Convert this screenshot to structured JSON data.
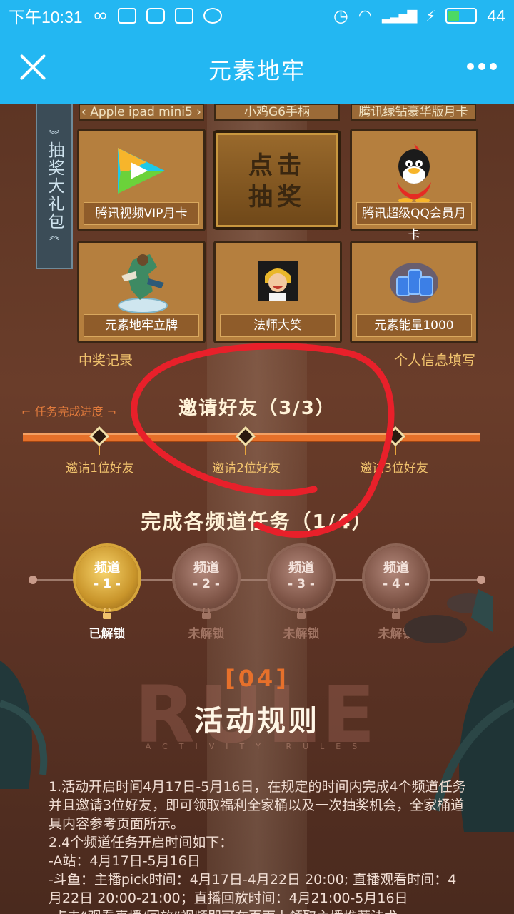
{
  "status_bar": {
    "time": "下午10:31",
    "battery": "44",
    "battery_level": 0.44
  },
  "title_bar": {
    "title": "元素地牢"
  },
  "side_tab": {
    "label": "抽奖大礼包"
  },
  "prizes": {
    "top_row": [
      "‹ Apple ipad mini5 ›",
      "小鸡G6手柄",
      "腾讯绿钻豪华版月卡"
    ],
    "items": [
      "腾讯视频VIP月卡",
      "腾讯超级QQ会员月卡",
      "元素地牢立牌",
      "法师大笑",
      "元素能量1000"
    ],
    "draw_button": {
      "line1": "点击",
      "line2": "抽奖"
    }
  },
  "links": {
    "records": "中奖记录",
    "info": "个人信息填写"
  },
  "invite": {
    "progress_tag": "任务完成进度",
    "title": "邀请好友（3/3）",
    "nodes": [
      "邀请1位好友",
      "邀请2位好友",
      "邀请3位好友"
    ]
  },
  "tasks": {
    "title": "完成各频道任务（1/4）",
    "channels": [
      {
        "label": "频道",
        "num": "- 1 -",
        "status": "已解锁"
      },
      {
        "label": "频道",
        "num": "- 2 -",
        "status": "未解锁"
      },
      {
        "label": "频道",
        "num": "- 3 -",
        "status": "未解锁"
      },
      {
        "label": "频道",
        "num": "- 4 -",
        "status": "未解锁"
      }
    ]
  },
  "rules": {
    "number": "[04]",
    "bg_word": "RULE",
    "title": "活动规则",
    "subtitle": "ACTIVITY RULES",
    "lines": [
      "1.活动开启时间4月17日-5月16日，在规定的时间内完成4个频道任务并且邀请3位好友，即可领取福利全家桶以及一次抽奖机会，全家桶道具内容参考页面所示。",
      "2.4个频道任务开启时间如下：",
      "-A站：4月17日-5月16日",
      "-斗鱼：主播pick时间：4月17日-4月22日 20:00; 直播观看时间：4月22日 20:00-21:00；直播回放时间：4月21:00-5月16日",
      "-点击“观看直播/回放”视频即可在页面上领取主播推荐法术"
    ]
  },
  "colors": {
    "header": "#23b7f2",
    "accent_orange": "#e5702a",
    "gold": "#f0c26d",
    "annotation_red": "#e8202a"
  }
}
